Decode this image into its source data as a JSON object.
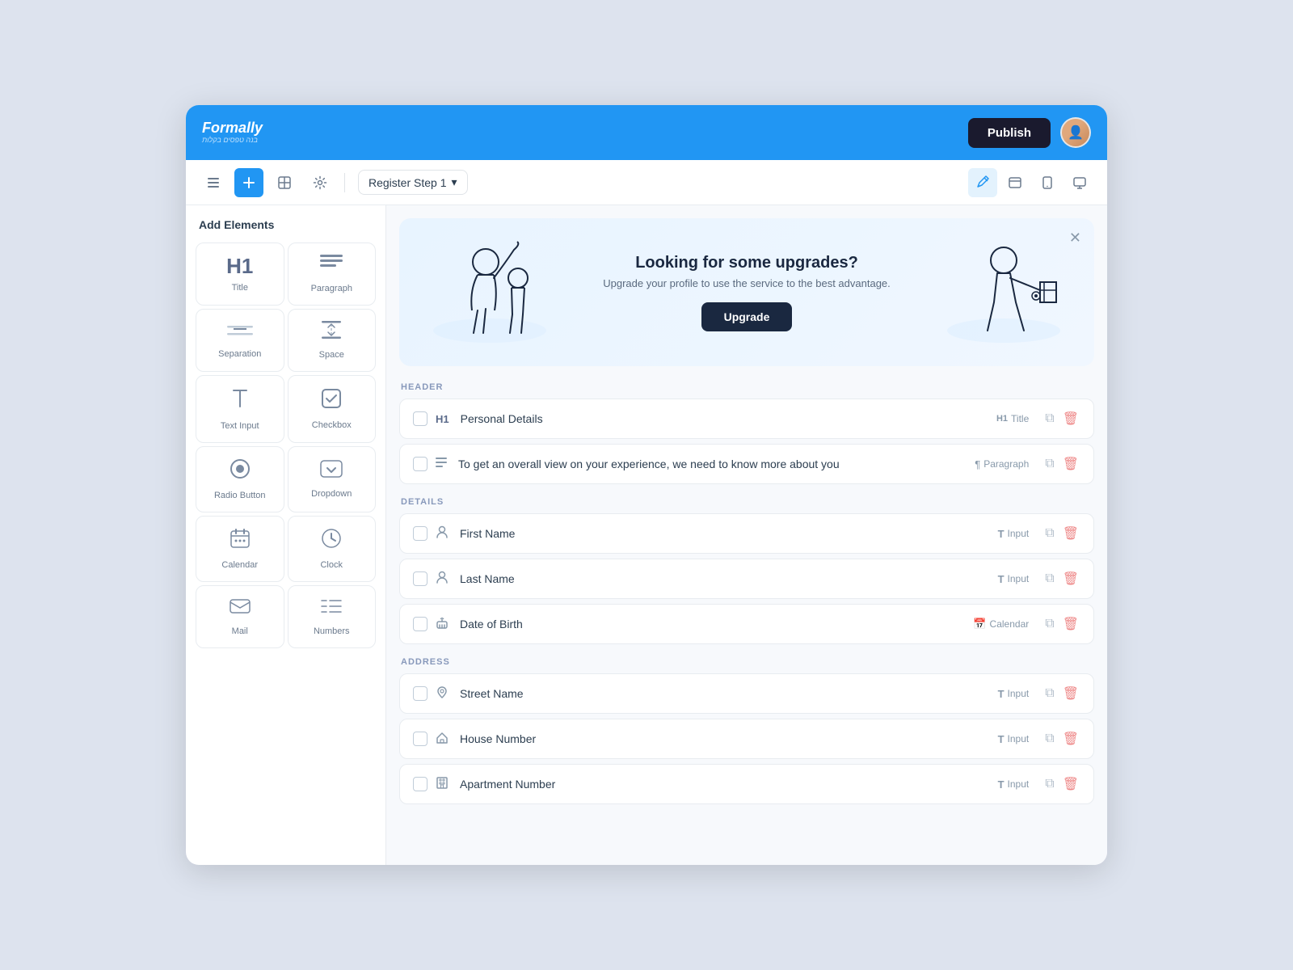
{
  "app": {
    "name": "Formally",
    "name_styled": "Form<em>ally</em>",
    "subtitle": "בנה טפסים בקלות"
  },
  "header": {
    "publish_label": "Publish",
    "avatar_initial": "👤"
  },
  "toolbar": {
    "step_label": "Register Step 1",
    "icons": [
      "list",
      "add",
      "table",
      "gear"
    ]
  },
  "sidebar": {
    "title": "Add Elements",
    "elements": [
      {
        "id": "title",
        "label": "Title",
        "icon": "H1"
      },
      {
        "id": "paragraph",
        "label": "Paragraph",
        "icon": "¶"
      },
      {
        "id": "separation",
        "label": "Separation",
        "icon": "sep"
      },
      {
        "id": "space",
        "label": "Space",
        "icon": "space"
      },
      {
        "id": "text-input",
        "label": "Text Input",
        "icon": "T"
      },
      {
        "id": "checkbox",
        "label": "Checkbox",
        "icon": "☑"
      },
      {
        "id": "radio",
        "label": "Radio Button",
        "icon": "◎"
      },
      {
        "id": "dropdown",
        "label": "Dropdown",
        "icon": "▾"
      },
      {
        "id": "calendar",
        "label": "Calendar",
        "icon": "📅"
      },
      {
        "id": "clock",
        "label": "Clock",
        "icon": "🕐"
      },
      {
        "id": "mail",
        "label": "Mail",
        "icon": "✉"
      },
      {
        "id": "numbers",
        "label": "Numbers",
        "icon": "≡"
      }
    ]
  },
  "banner": {
    "title": "Looking for some upgrades?",
    "subtitle": "Upgrade your profile to use the service to the best advantage.",
    "button_label": "Upgrade"
  },
  "sections": [
    {
      "label": "HEADER",
      "rows": [
        {
          "checkbox": false,
          "icon": "H1",
          "label": "Personal Details",
          "type_icon": "H1",
          "type_label": "Title"
        },
        {
          "checkbox": false,
          "icon": "¶",
          "label": "To get an overall view on your experience, we need to know more about you",
          "type_icon": "¶",
          "type_label": "Paragraph"
        }
      ]
    },
    {
      "label": "DETAILS",
      "rows": [
        {
          "checkbox": false,
          "icon": "👤",
          "label": "First Name",
          "type_icon": "T",
          "type_label": "Input"
        },
        {
          "checkbox": false,
          "icon": "👤",
          "label": "Last Name",
          "type_icon": "T",
          "type_label": "Input"
        },
        {
          "checkbox": false,
          "icon": "🎂",
          "label": "Date of Birth",
          "type_icon": "📅",
          "type_label": "Calendar"
        }
      ]
    },
    {
      "label": "ADDRESS",
      "rows": [
        {
          "checkbox": false,
          "icon": "📍",
          "label": "Street Name",
          "type_icon": "T",
          "type_label": "Input"
        },
        {
          "checkbox": false,
          "icon": "🏠",
          "label": "House Number",
          "type_icon": "T",
          "type_label": "Input"
        },
        {
          "checkbox": false,
          "icon": "🏢",
          "label": "Apartment Number",
          "type_icon": "T",
          "type_label": "Input"
        }
      ]
    }
  ]
}
